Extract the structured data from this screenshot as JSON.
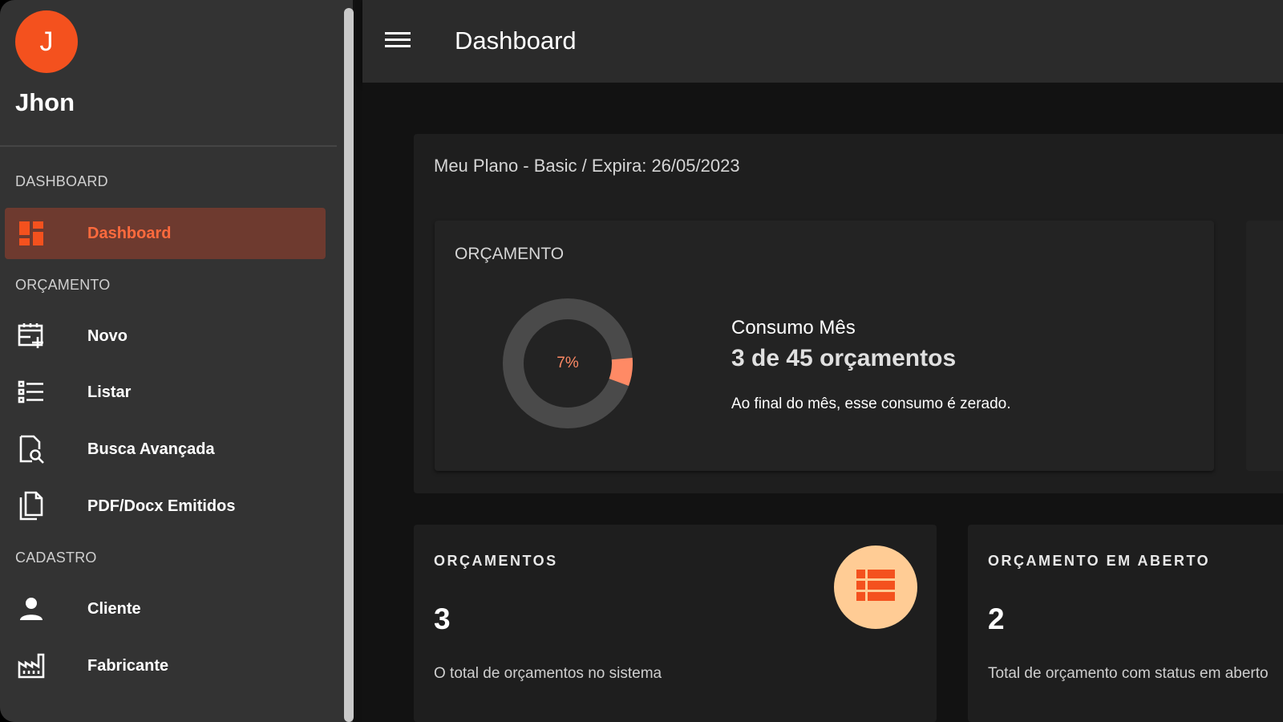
{
  "user": {
    "initial": "J",
    "name": "Jhon"
  },
  "sidebar": {
    "sections": [
      {
        "label": "DASHBOARD"
      },
      {
        "label": "ORÇAMENTO"
      },
      {
        "label": "CADASTRO"
      }
    ],
    "items": [
      {
        "label": "Dashboard",
        "icon": "dashboard-icon",
        "active": true
      },
      {
        "label": "Novo",
        "icon": "calendar-add-icon"
      },
      {
        "label": "Listar",
        "icon": "list-icon"
      },
      {
        "label": "Busca Avançada",
        "icon": "document-search-icon"
      },
      {
        "label": "PDF/Docx Emitidos",
        "icon": "documents-icon"
      },
      {
        "label": "Cliente",
        "icon": "person-icon"
      },
      {
        "label": "Fabricante",
        "icon": "factory-icon"
      }
    ]
  },
  "header": {
    "title": "Dashboard",
    "menu_icon": "menu-icon"
  },
  "plan": {
    "title": "Meu Plano - Basic / Expira: 26/05/2023",
    "section_label": "ORÇAMENTO",
    "usage_percent_label": "7%",
    "usage_fraction": 0.07,
    "consumo_label": "Consumo Mês",
    "consumo_value": "3 de 45 orçamentos",
    "consumo_note": "Ao final do mês, esse consumo é zerado."
  },
  "stats": [
    {
      "title": "ORÇAMENTOS",
      "value": "3",
      "description": "O total de orçamentos no sistema",
      "icon": "table-icon"
    },
    {
      "title": "ORÇAMENTO EM ABERTO",
      "value": "2",
      "description": "Total de orçamento com status em aberto"
    }
  ],
  "colors": {
    "accent": "#f4511e",
    "active_bg": "#6e3a2f",
    "active_text": "#ff6a3d",
    "donut_track": "#4a4a4a",
    "donut_fill": "#ff8a65",
    "badge_bg": "#ffcc95"
  }
}
